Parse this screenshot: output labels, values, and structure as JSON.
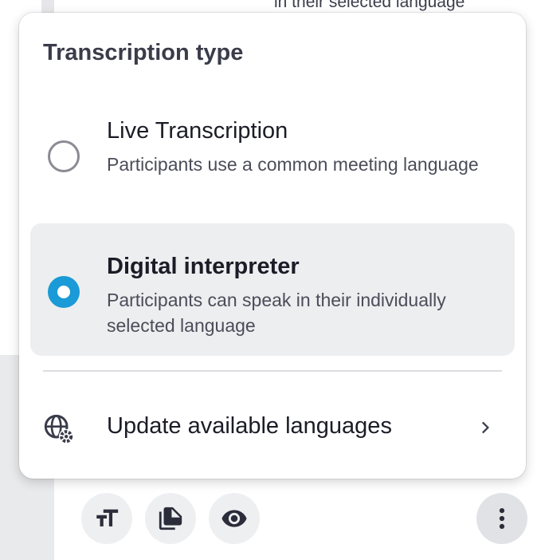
{
  "background": {
    "cut_text": "in their selected language"
  },
  "popover": {
    "title": "Transcription type",
    "options": [
      {
        "title": "Live Transcription",
        "description": "Participants use a common meeting language",
        "selected": false
      },
      {
        "title": "Digital interpreter",
        "description": "Participants can speak in their individually selected language",
        "selected": true
      }
    ],
    "update_languages": {
      "label": "Update available languages",
      "icon": "globe-settings-icon"
    }
  },
  "toolbar": {
    "buttons": [
      {
        "icon": "text-size-icon"
      },
      {
        "icon": "document-icon"
      },
      {
        "icon": "eye-icon"
      },
      {
        "icon": "more-vertical-icon"
      }
    ]
  },
  "colors": {
    "accent": "#1a9ad6",
    "selected_bg": "#edeef0",
    "text_primary": "#1b1c26",
    "text_secondary": "#4b4d59"
  }
}
